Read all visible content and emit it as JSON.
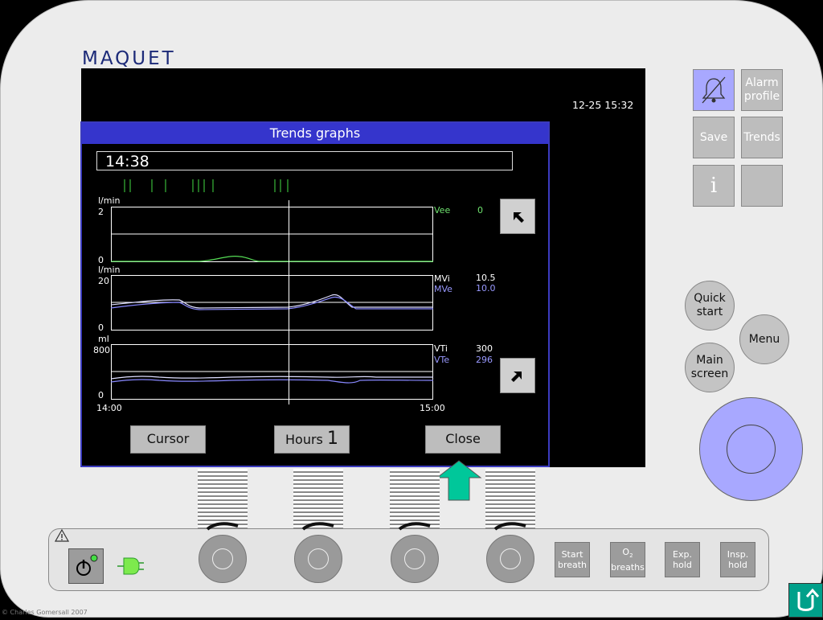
{
  "brand": "MAQUET",
  "clock": "12-25 15:32",
  "dialog": {
    "title": "Trends graphs",
    "cursor_time": "14:38",
    "charts": [
      {
        "unit": "l/min",
        "ymax": "2",
        "ymin": "0",
        "labels": [
          {
            "name": "Vee",
            "value": "0",
            "color": "#6fe36f"
          }
        ]
      },
      {
        "unit": "l/min",
        "ymax": "20",
        "ymin": "0",
        "labels": [
          {
            "name": "MVi",
            "value": "10.5",
            "color": "#ffffff"
          },
          {
            "name": "MVe",
            "value": "10.0",
            "color": "#9999ff"
          }
        ]
      },
      {
        "unit": "ml",
        "ymax": "800",
        "ymin": "0",
        "labels": [
          {
            "name": "VTi",
            "value": "300",
            "color": "#ffffff"
          },
          {
            "name": "VTe",
            "value": "296",
            "color": "#9999ff"
          }
        ]
      }
    ],
    "x_start": "14:00",
    "x_end": "15:00",
    "buttons": {
      "cursor": "Cursor",
      "hours_label": "Hours",
      "hours_value": "1",
      "close": "Close"
    }
  },
  "side_buttons": {
    "alarm_profile": "Alarm profile",
    "save": "Save",
    "trends": "Trends",
    "info": "i",
    "quick_start": "Quick start",
    "menu": "Menu",
    "main_screen": "Main screen"
  },
  "bottom_buttons": {
    "start_breath": "Start breath",
    "o2_breaths_prefix": "O",
    "o2_breaths_sub": "2",
    "o2_breaths_suffix": "breaths",
    "exp_hold": "Exp. hold",
    "insp_hold": "Insp. hold"
  },
  "copyright": "© Charles Gomersall 2007",
  "colors": {
    "dialog_blue": "#3535cc",
    "accent_green": "#00c79a",
    "alarm_blue": "#a8a8ff",
    "knob_blue": "#a8a8ff"
  }
}
